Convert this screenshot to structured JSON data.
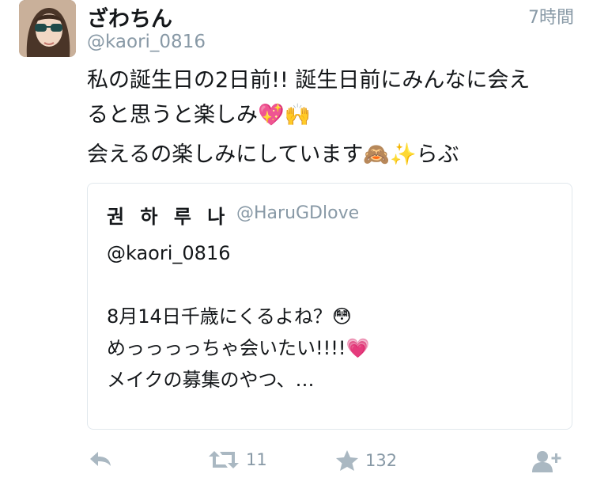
{
  "tweet": {
    "display_name": "ざわちん",
    "username": "@kaori_0816",
    "time": "7時間",
    "lines": [
      "私の誕生日の2日前!! 誕生日前にみんなに会え",
      "ると思うと楽しみ💖🙌",
      "会えるの楽しみにしています🙈✨らぶ"
    ]
  },
  "quoted": {
    "name": "권 하 루 나",
    "handle": "@HaruGDlove",
    "lines": [
      "@kaori_0816",
      "",
      "8月14日千歳にくるよね？😳",
      "めっっっっちゃ会いたい!!!!💗",
      "メイクの募集のやつ、…"
    ]
  },
  "actions": {
    "reply_icon": "reply-icon",
    "retweet_icon": "retweet-icon",
    "retweet_count": "11",
    "favorite_icon": "star-icon",
    "favorite_count": "132",
    "follow_icon": "follow-icon"
  },
  "colors": {
    "text": "#14171a",
    "secondary": "#8899a6",
    "icon": "#aab8c2",
    "border": "#e1e8ed"
  }
}
